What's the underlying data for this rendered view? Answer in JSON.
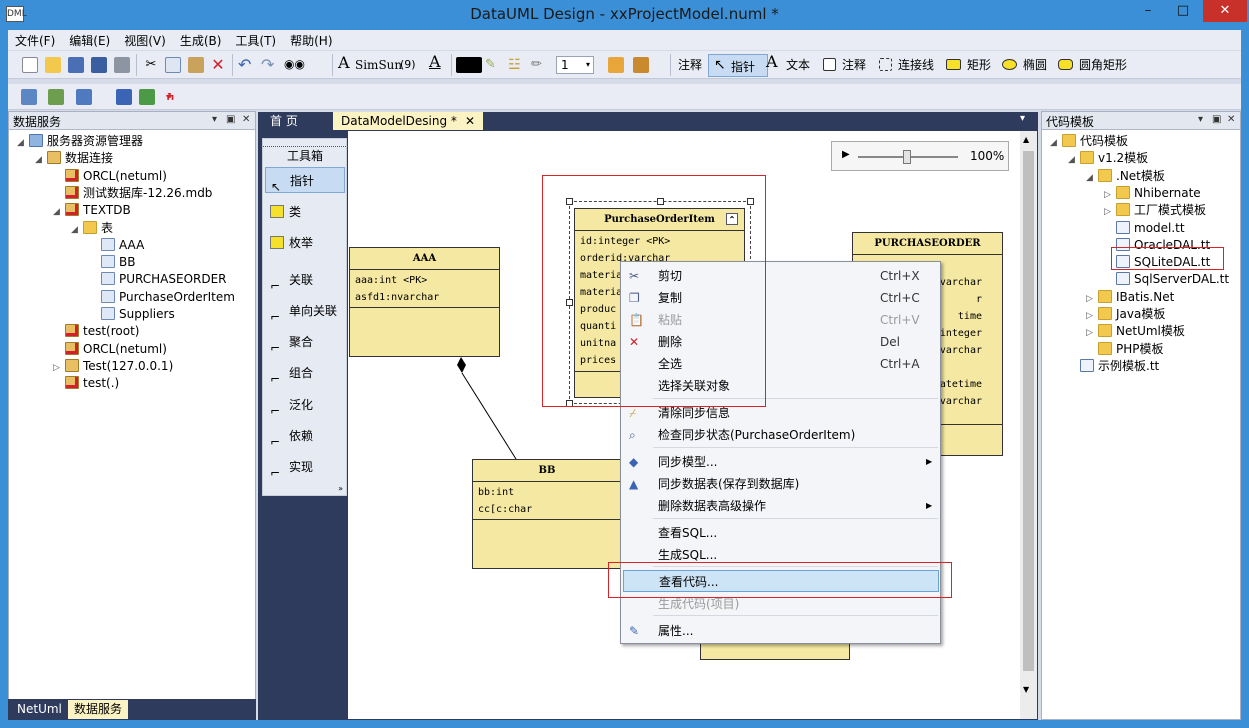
{
  "window": {
    "title": "DataUML Design - xxProjectModel.numl *",
    "icon_text": "DML"
  },
  "menu": [
    "文件(F)",
    "编辑(E)",
    "视图(V)",
    "生成(B)",
    "工具(T)",
    "帮助(H)"
  ],
  "toolbar": {
    "font_name": "SimSun",
    "font_size": "(9)",
    "line_width": "1",
    "comment1": "注释",
    "pointer": "指针",
    "text": "文本",
    "comment2": "注释",
    "connector": "连接线",
    "rect": "矩形",
    "ellipse": "椭圆",
    "round_rect": "圆角矩形"
  },
  "left_panel": {
    "title": "数据服务",
    "tree": [
      {
        "label": "服务器资源管理器",
        "level": 0,
        "icon": "server-icon",
        "exp": "expanded"
      },
      {
        "label": "数据连接",
        "level": 1,
        "icon": "db-icon",
        "exp": "expanded"
      },
      {
        "label": "ORCL(netuml)",
        "level": 2,
        "icon": "db-error-icon",
        "exp": ""
      },
      {
        "label": "测试数据库-12.26.mdb",
        "level": 2,
        "icon": "db-error-icon",
        "exp": ""
      },
      {
        "label": "TEXTDB",
        "level": 2,
        "icon": "db-error-icon",
        "exp": "expanded"
      },
      {
        "label": "表",
        "level": 3,
        "icon": "folder-icon",
        "exp": "expanded"
      },
      {
        "label": "AAA",
        "level": 4,
        "icon": "table-icon",
        "exp": ""
      },
      {
        "label": "BB",
        "level": 4,
        "icon": "table-icon",
        "exp": ""
      },
      {
        "label": "PURCHASEORDER",
        "level": 4,
        "icon": "table-icon",
        "exp": ""
      },
      {
        "label": "PurchaseOrderItem",
        "level": 4,
        "icon": "table-icon",
        "exp": ""
      },
      {
        "label": "Suppliers",
        "level": 4,
        "icon": "table-icon",
        "exp": ""
      },
      {
        "label": "test(root)",
        "level": 2,
        "icon": "db-error-icon",
        "exp": ""
      },
      {
        "label": "ORCL(netuml)",
        "level": 2,
        "icon": "db-error-icon",
        "exp": ""
      },
      {
        "label": "Test(127.0.0.1)",
        "level": 2,
        "icon": "db-icon",
        "exp": "collapsed"
      },
      {
        "label": "test(.)",
        "level": 2,
        "icon": "db-error-icon",
        "exp": ""
      }
    ]
  },
  "bottom_tabs": [
    "NetUml",
    "数据服务"
  ],
  "doc_tabs": {
    "home": "首 页",
    "active": "DataModelDesing *",
    "close": "✕"
  },
  "toolbox": {
    "title": "工具箱",
    "items": [
      "指针",
      "类",
      "枚举",
      "关联",
      "单向关联",
      "聚合",
      "组合",
      "泛化",
      "依赖",
      "实现"
    ]
  },
  "zoom": {
    "value": "100%",
    "level": 0.45
  },
  "classes": {
    "aaa": {
      "name": "AAA",
      "fields": [
        "aaa:int <PK>",
        "asfd1:nvarchar"
      ]
    },
    "bb": {
      "name": "BB",
      "fields": [
        "bb:int",
        "cc[c:char"
      ]
    },
    "poi": {
      "name": "PurchaseOrderItem",
      "fields": [
        "id:integer <PK>",
        "orderid:varchar",
        "materia",
        "materia",
        "produc",
        "quanti",
        "unitna",
        "prices"
      ]
    },
    "po": {
      "name": "PURCHASEORDER",
      "fields": [
        "",
        "varchar",
        "r",
        "time",
        "integer",
        "varchar",
        "",
        "datetime",
        "varchar"
      ]
    }
  },
  "context_menu": [
    {
      "label": "剪切",
      "shortcut": "Ctrl+X",
      "icon": "cut-icon",
      "disabled": false
    },
    {
      "label": "复制",
      "shortcut": "Ctrl+C",
      "icon": "copy-icon",
      "disabled": false
    },
    {
      "label": "粘贴",
      "shortcut": "Ctrl+V",
      "icon": "paste-icon",
      "disabled": true
    },
    {
      "label": "删除",
      "shortcut": "Del",
      "icon": "delete-icon",
      "disabled": false
    },
    {
      "label": "全选",
      "shortcut": "Ctrl+A",
      "icon": "",
      "disabled": false
    },
    {
      "label": "选择关联对象",
      "shortcut": "",
      "icon": "",
      "disabled": false
    },
    {
      "label": "清除同步信息",
      "shortcut": "",
      "icon": "broom-icon",
      "disabled": false
    },
    {
      "label": "检查同步状态(PurchaseOrderItem)",
      "shortcut": "",
      "icon": "check-sync-icon",
      "disabled": false
    },
    {
      "label": "同步模型...",
      "shortcut": "",
      "icon": "sync-model-icon",
      "disabled": false,
      "submenu": true
    },
    {
      "label": "同步数据表(保存到数据库)",
      "shortcut": "",
      "icon": "sync-table-icon",
      "disabled": false
    },
    {
      "label": "删除数据表高级操作",
      "shortcut": "",
      "icon": "",
      "disabled": false,
      "submenu": true
    },
    {
      "label": "查看SQL...",
      "shortcut": "",
      "icon": "",
      "disabled": false
    },
    {
      "label": "生成SQL...",
      "shortcut": "",
      "icon": "",
      "disabled": false
    },
    {
      "label": "查看代码...",
      "shortcut": "",
      "icon": "",
      "disabled": false,
      "highlight": true
    },
    {
      "label": "生成代码(项目)",
      "shortcut": "",
      "icon": "",
      "disabled": true
    },
    {
      "label": "属性...",
      "shortcut": "",
      "icon": "properties-icon",
      "disabled": false
    }
  ],
  "right_panel": {
    "title": "代码模板",
    "tree": [
      {
        "label": "代码模板",
        "level": 0,
        "icon": "folder-icon",
        "exp": "expanded"
      },
      {
        "label": "v1.2模板",
        "level": 1,
        "icon": "folder-icon",
        "exp": "expanded"
      },
      {
        "label": ".Net模板",
        "level": 2,
        "icon": "folder-icon",
        "exp": "expanded"
      },
      {
        "label": "Nhibernate",
        "level": 3,
        "icon": "folder-icon",
        "exp": "collapsed"
      },
      {
        "label": "工厂模式模板",
        "level": 3,
        "icon": "folder-icon",
        "exp": "collapsed"
      },
      {
        "label": "model.tt",
        "level": 3,
        "icon": "template-file-icon",
        "exp": ""
      },
      {
        "label": "OracleDAL.tt",
        "level": 3,
        "icon": "template-file-icon",
        "exp": ""
      },
      {
        "label": "SQLiteDAL.tt",
        "level": 3,
        "icon": "template-file-icon",
        "exp": ""
      },
      {
        "label": "SqlServerDAL.tt",
        "level": 3,
        "icon": "template-file-icon",
        "exp": ""
      },
      {
        "label": "IBatis.Net",
        "level": 2,
        "icon": "folder-icon",
        "exp": "collapsed"
      },
      {
        "label": "Java模板",
        "level": 2,
        "icon": "folder-icon",
        "exp": "collapsed"
      },
      {
        "label": "NetUml模板",
        "level": 2,
        "icon": "folder-icon",
        "exp": "collapsed"
      },
      {
        "label": "PHP模板",
        "level": 2,
        "icon": "folder-icon",
        "exp": ""
      },
      {
        "label": "示例模板.tt",
        "level": 1,
        "icon": "template-file-icon",
        "exp": ""
      }
    ]
  },
  "colors": {
    "chrome": "#3a8fd6",
    "class_fill": "#f4e8a2",
    "highlight": "#cde4f7",
    "annotation": "#d9232a"
  }
}
